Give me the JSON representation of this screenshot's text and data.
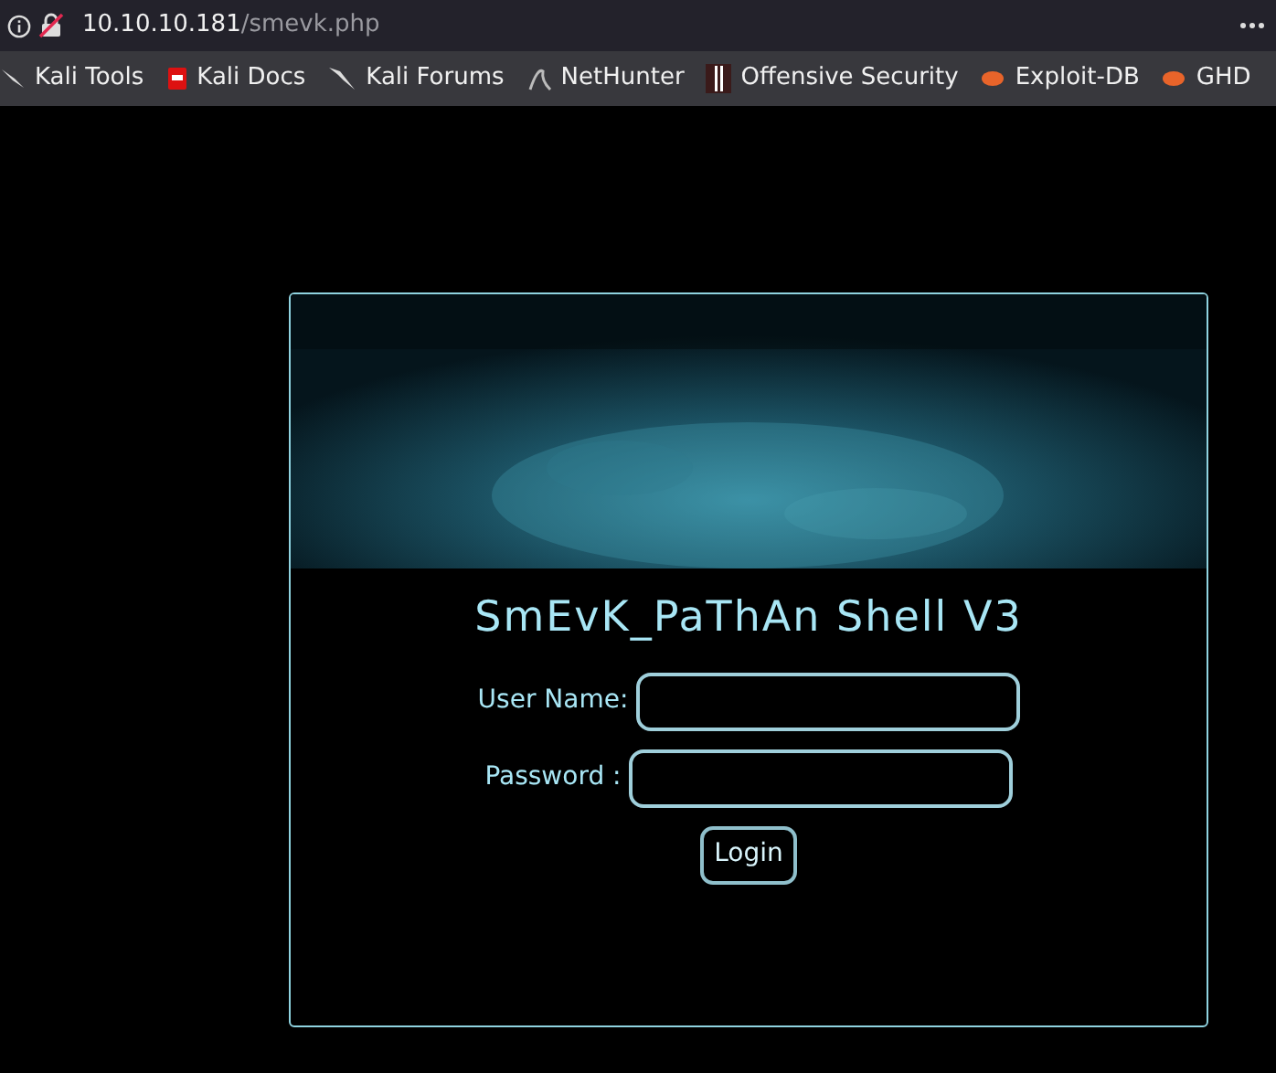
{
  "address_bar": {
    "host": "10.10.10.181",
    "path": "/smevk.php"
  },
  "bookmarks": [
    {
      "label": "Kali Tools"
    },
    {
      "label": "Kali Docs"
    },
    {
      "label": "Kali Forums"
    },
    {
      "label": "NetHunter"
    },
    {
      "label": "Offensive Security"
    },
    {
      "label": "Exploit-DB"
    },
    {
      "label": "GHD"
    }
  ],
  "login": {
    "title": "SmEvK_PaThAn Shell V3",
    "fields": [
      {
        "label": "User Name:"
      },
      {
        "label": "Password :"
      }
    ],
    "button": "Login"
  }
}
